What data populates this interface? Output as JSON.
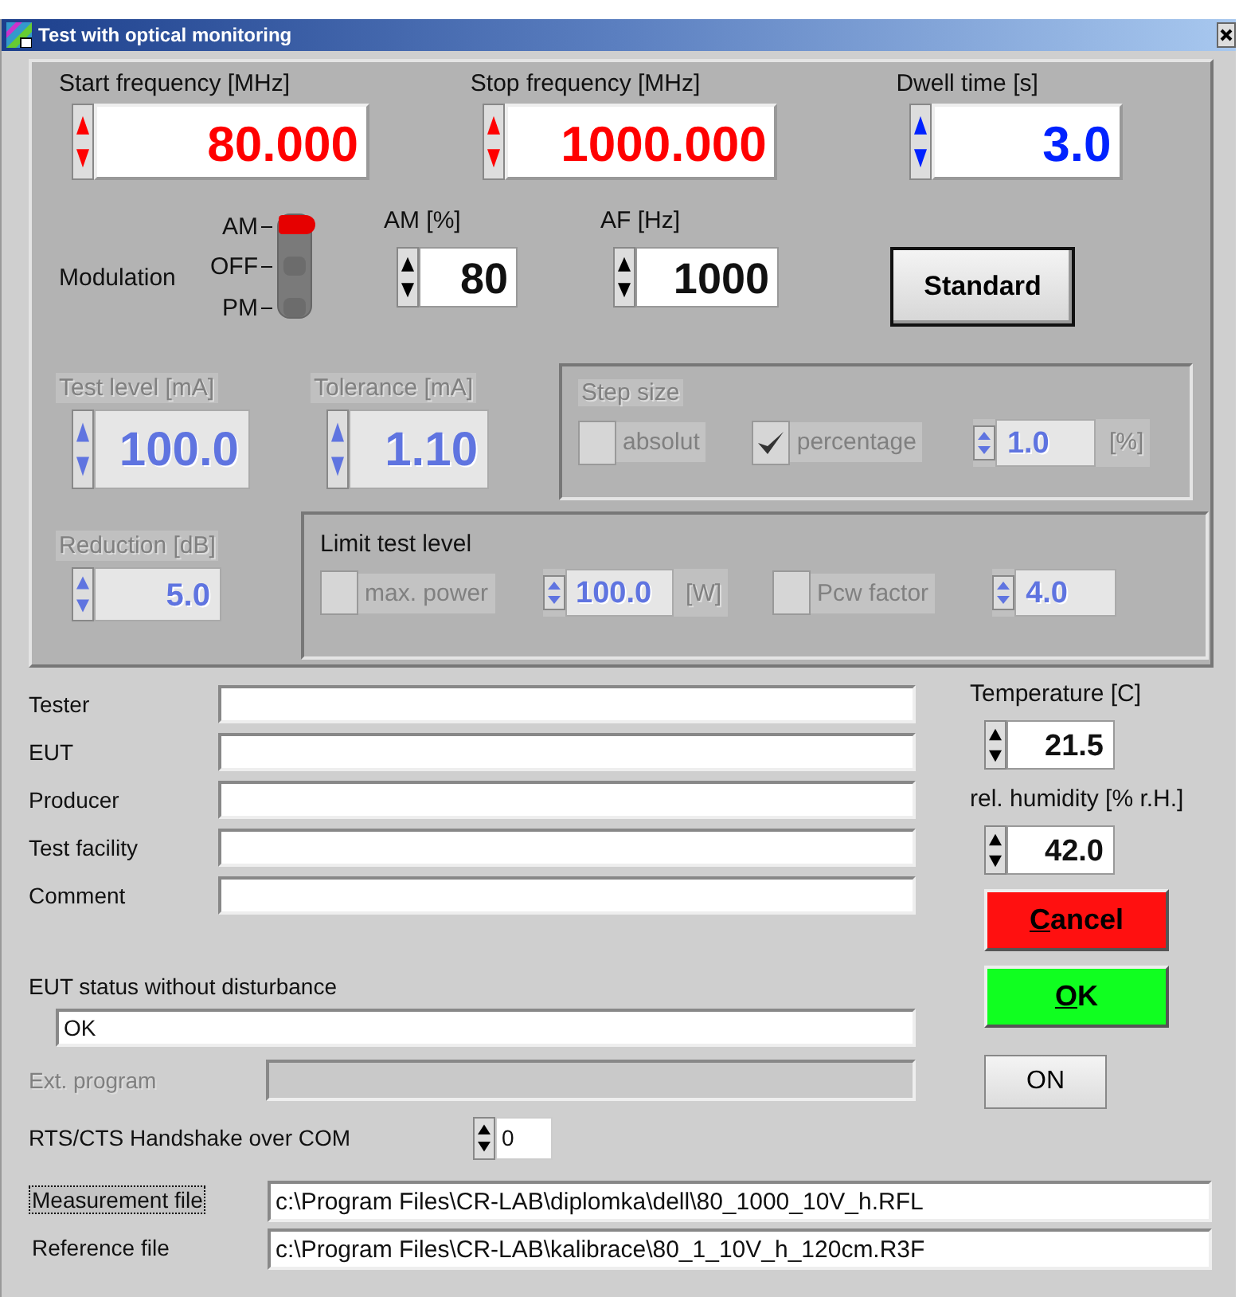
{
  "window": {
    "title": "Test with optical monitoring"
  },
  "frequency_controls": [
    {
      "label": "Start frequency [MHz]",
      "value": "80.000",
      "color": "#ff0000"
    },
    {
      "label": "Stop frequency [MHz]",
      "value": "1000.000",
      "color": "#ff0000"
    },
    {
      "label": "Dwell time [s]",
      "value": "3.0",
      "color": "#0022ff"
    }
  ],
  "modulation": {
    "label": "Modulation",
    "positions": [
      {
        "label": "AM",
        "selected": true
      },
      {
        "label": "OFF",
        "selected": false
      },
      {
        "label": "PM",
        "selected": false
      }
    ]
  },
  "am": {
    "label": "AM [%]",
    "value": "80"
  },
  "af": {
    "label": "AF [Hz]",
    "value": "1000"
  },
  "standard_button": {
    "label": "Standard"
  },
  "test_level": {
    "label": "Test level [mA]",
    "value": "100.0",
    "disabled": true
  },
  "tolerance": {
    "label": "Tolerance [mA]",
    "value": "1.10",
    "disabled": true
  },
  "step_size": {
    "title": "Step size",
    "disabled": true,
    "items": [
      {
        "kind": "checkbox",
        "label": "absolut",
        "checked": false
      },
      {
        "kind": "checkbox",
        "label": "percentage",
        "checked": true
      },
      {
        "kind": "numeric",
        "value": "1.0",
        "unit": "[%]"
      }
    ]
  },
  "reduction": {
    "label": "Reduction [dB]",
    "value": "5.0",
    "disabled": true
  },
  "limit_test_level": {
    "title": "Limit test level",
    "disabled": false,
    "items": [
      {
        "kind": "checkbox",
        "label": "max. power",
        "checked": false
      },
      {
        "kind": "numeric",
        "value": "100.0",
        "unit": "[W]"
      },
      {
        "kind": "checkbox",
        "label": "Pcw factor",
        "checked": false
      },
      {
        "kind": "numeric",
        "value": "4.0"
      }
    ]
  },
  "info_fields": [
    {
      "label": "Tester"
    },
    {
      "label": "EUT"
    },
    {
      "label": "Producer"
    },
    {
      "label": "Test facility"
    },
    {
      "label": "Comment"
    }
  ],
  "temperature": {
    "label": "Temperature [C]",
    "value": "21.5"
  },
  "humidity": {
    "label": "rel. humidity [% r.H.]",
    "value": "42.0"
  },
  "action_buttons": [
    {
      "label": "Cancel",
      "color": "#ff1010",
      "underline_first": true
    },
    {
      "label": "OK",
      "color": "#10ff20",
      "underline_first": true
    }
  ],
  "on_button": {
    "label": "ON"
  },
  "eut_status": {
    "label": "EUT status without disturbance",
    "value": "OK"
  },
  "ext_program": {
    "label": "Ext. program",
    "disabled": true
  },
  "handshake": {
    "label": "RTS/CTS Handshake over COM",
    "value": "0"
  },
  "files": [
    {
      "label": "Measurement file",
      "value": "c:\\Program Files\\CR-LAB\\diplomka\\dell\\80_1000_10V_h.RFL",
      "focused": true
    },
    {
      "label": "Reference file",
      "value": "c:\\Program Files\\CR-LAB\\kalibrace\\80_1_10V_h_120cm.R3F",
      "focused": false
    }
  ]
}
